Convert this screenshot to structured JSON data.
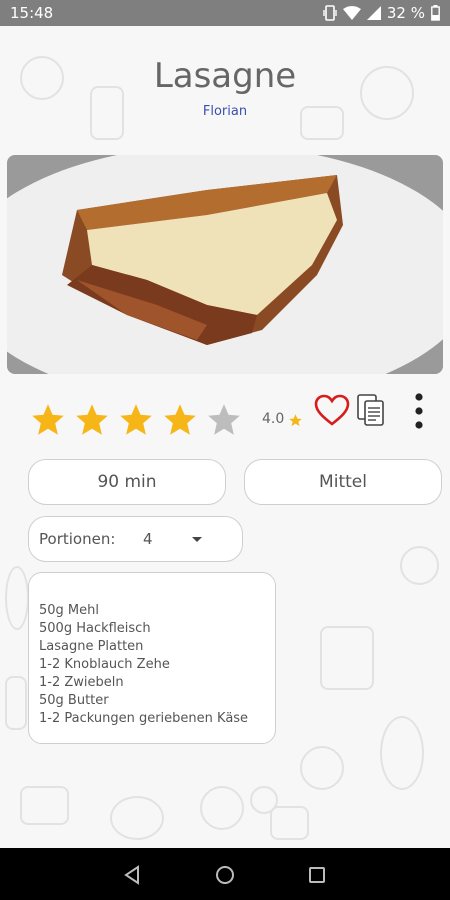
{
  "status_bar": {
    "time": "15:48",
    "battery": "32 %",
    "icons": [
      "vibrate-icon",
      "wifi-icon",
      "signal-icon",
      "battery-icon"
    ]
  },
  "recipe": {
    "title": "Lasagne",
    "author": "Florian",
    "rating_value": "4.0",
    "stars_filled": 4,
    "stars_total": 5,
    "time": "90 min",
    "difficulty": "Mittel",
    "portions_label": "Portionen:",
    "portions_value": "4",
    "ingredients": [
      "50g Mehl",
      "500g Hackfleisch",
      "Lasagne Platten",
      "1-2 Knoblauch Zehe",
      "1-2 Zwiebeln",
      "50g Butter",
      "1-2 Packungen geriebenen Käse"
    ]
  },
  "colors": {
    "star_filled": "#f6b617",
    "star_empty": "#bdbdbd",
    "heart": "#d81b1b",
    "author_link": "#3b4fb0"
  },
  "navigation": {
    "icons": [
      "back-icon",
      "home-icon",
      "recents-icon"
    ]
  }
}
